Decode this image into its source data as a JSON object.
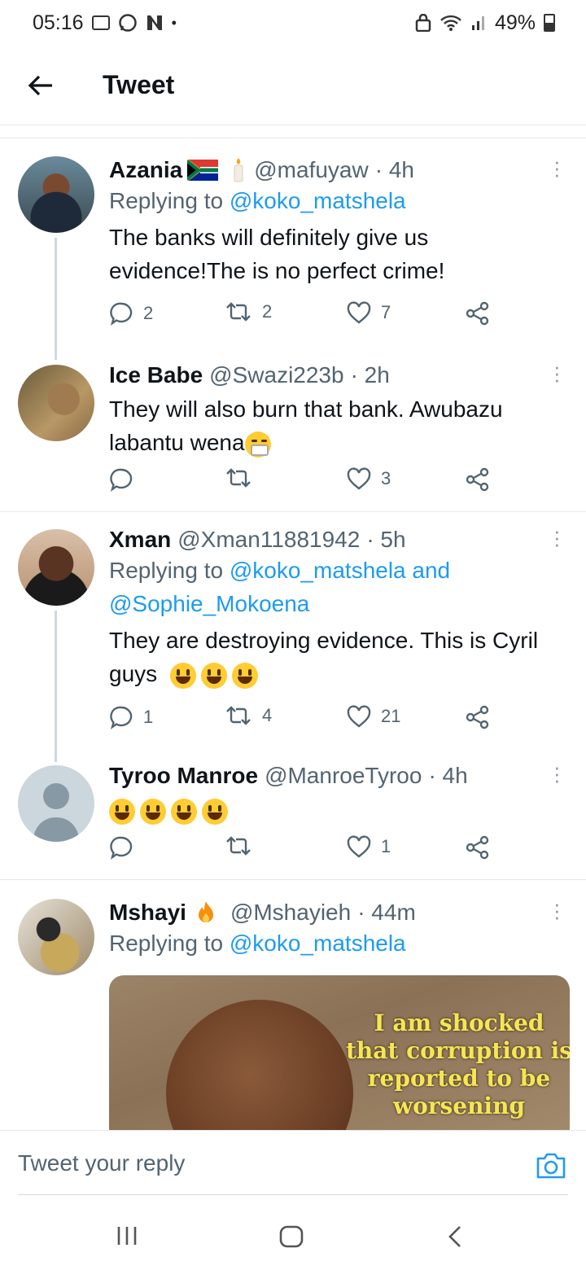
{
  "status": {
    "time": "05:16",
    "battery": "49%"
  },
  "header": {
    "title": "Tweet"
  },
  "tweets": [
    {
      "name": "Azania",
      "handle": "@mafuyaw",
      "time": "· 4h",
      "replying_prefix": "Replying to ",
      "replying_to": "@koko_matshela",
      "text": "The banks will definitely give us evidence!The is no perfect crime!",
      "replies": "2",
      "retweets": "2",
      "likes": "7"
    },
    {
      "name": "Ice Babe",
      "handle": "@Swazi223b",
      "time": "· 2h",
      "text": "They will also burn that bank. Awubazu labantu wena",
      "replies": "",
      "retweets": "",
      "likes": "3"
    },
    {
      "name": "Xman",
      "handle": "@Xman11881942",
      "time": "· 5h",
      "replying_prefix": "Replying to ",
      "replying_to": "@koko_matshela and @Sophie_Mokoena",
      "text": "They are destroying evidence. This is Cyril guys",
      "replies": "1",
      "retweets": "4",
      "likes": "21"
    },
    {
      "name": "Tyroo Manroe",
      "handle": "@ManroeTyroo",
      "time": "· 4h",
      "text": "",
      "replies": "",
      "retweets": "",
      "likes": "1"
    },
    {
      "name": "Mshayi",
      "handle": "@Mshayieh",
      "time": "· 44m",
      "replying_prefix": "Replying to ",
      "replying_to": "@koko_matshela",
      "media_text": "I am shocked that corruption is reported to be worsening"
    }
  ],
  "reply_box": {
    "placeholder": "Tweet your reply"
  },
  "icons": {
    "back": "arrow-left-icon",
    "reply": "reply-bubble-icon",
    "retweet": "retweet-icon",
    "like": "heart-icon",
    "share": "share-icon",
    "more": "more-vertical-icon",
    "camera": "camera-icon"
  },
  "colors": {
    "link": "#1d9bf0",
    "muted": "#536471",
    "divider": "#e6e9ec"
  }
}
